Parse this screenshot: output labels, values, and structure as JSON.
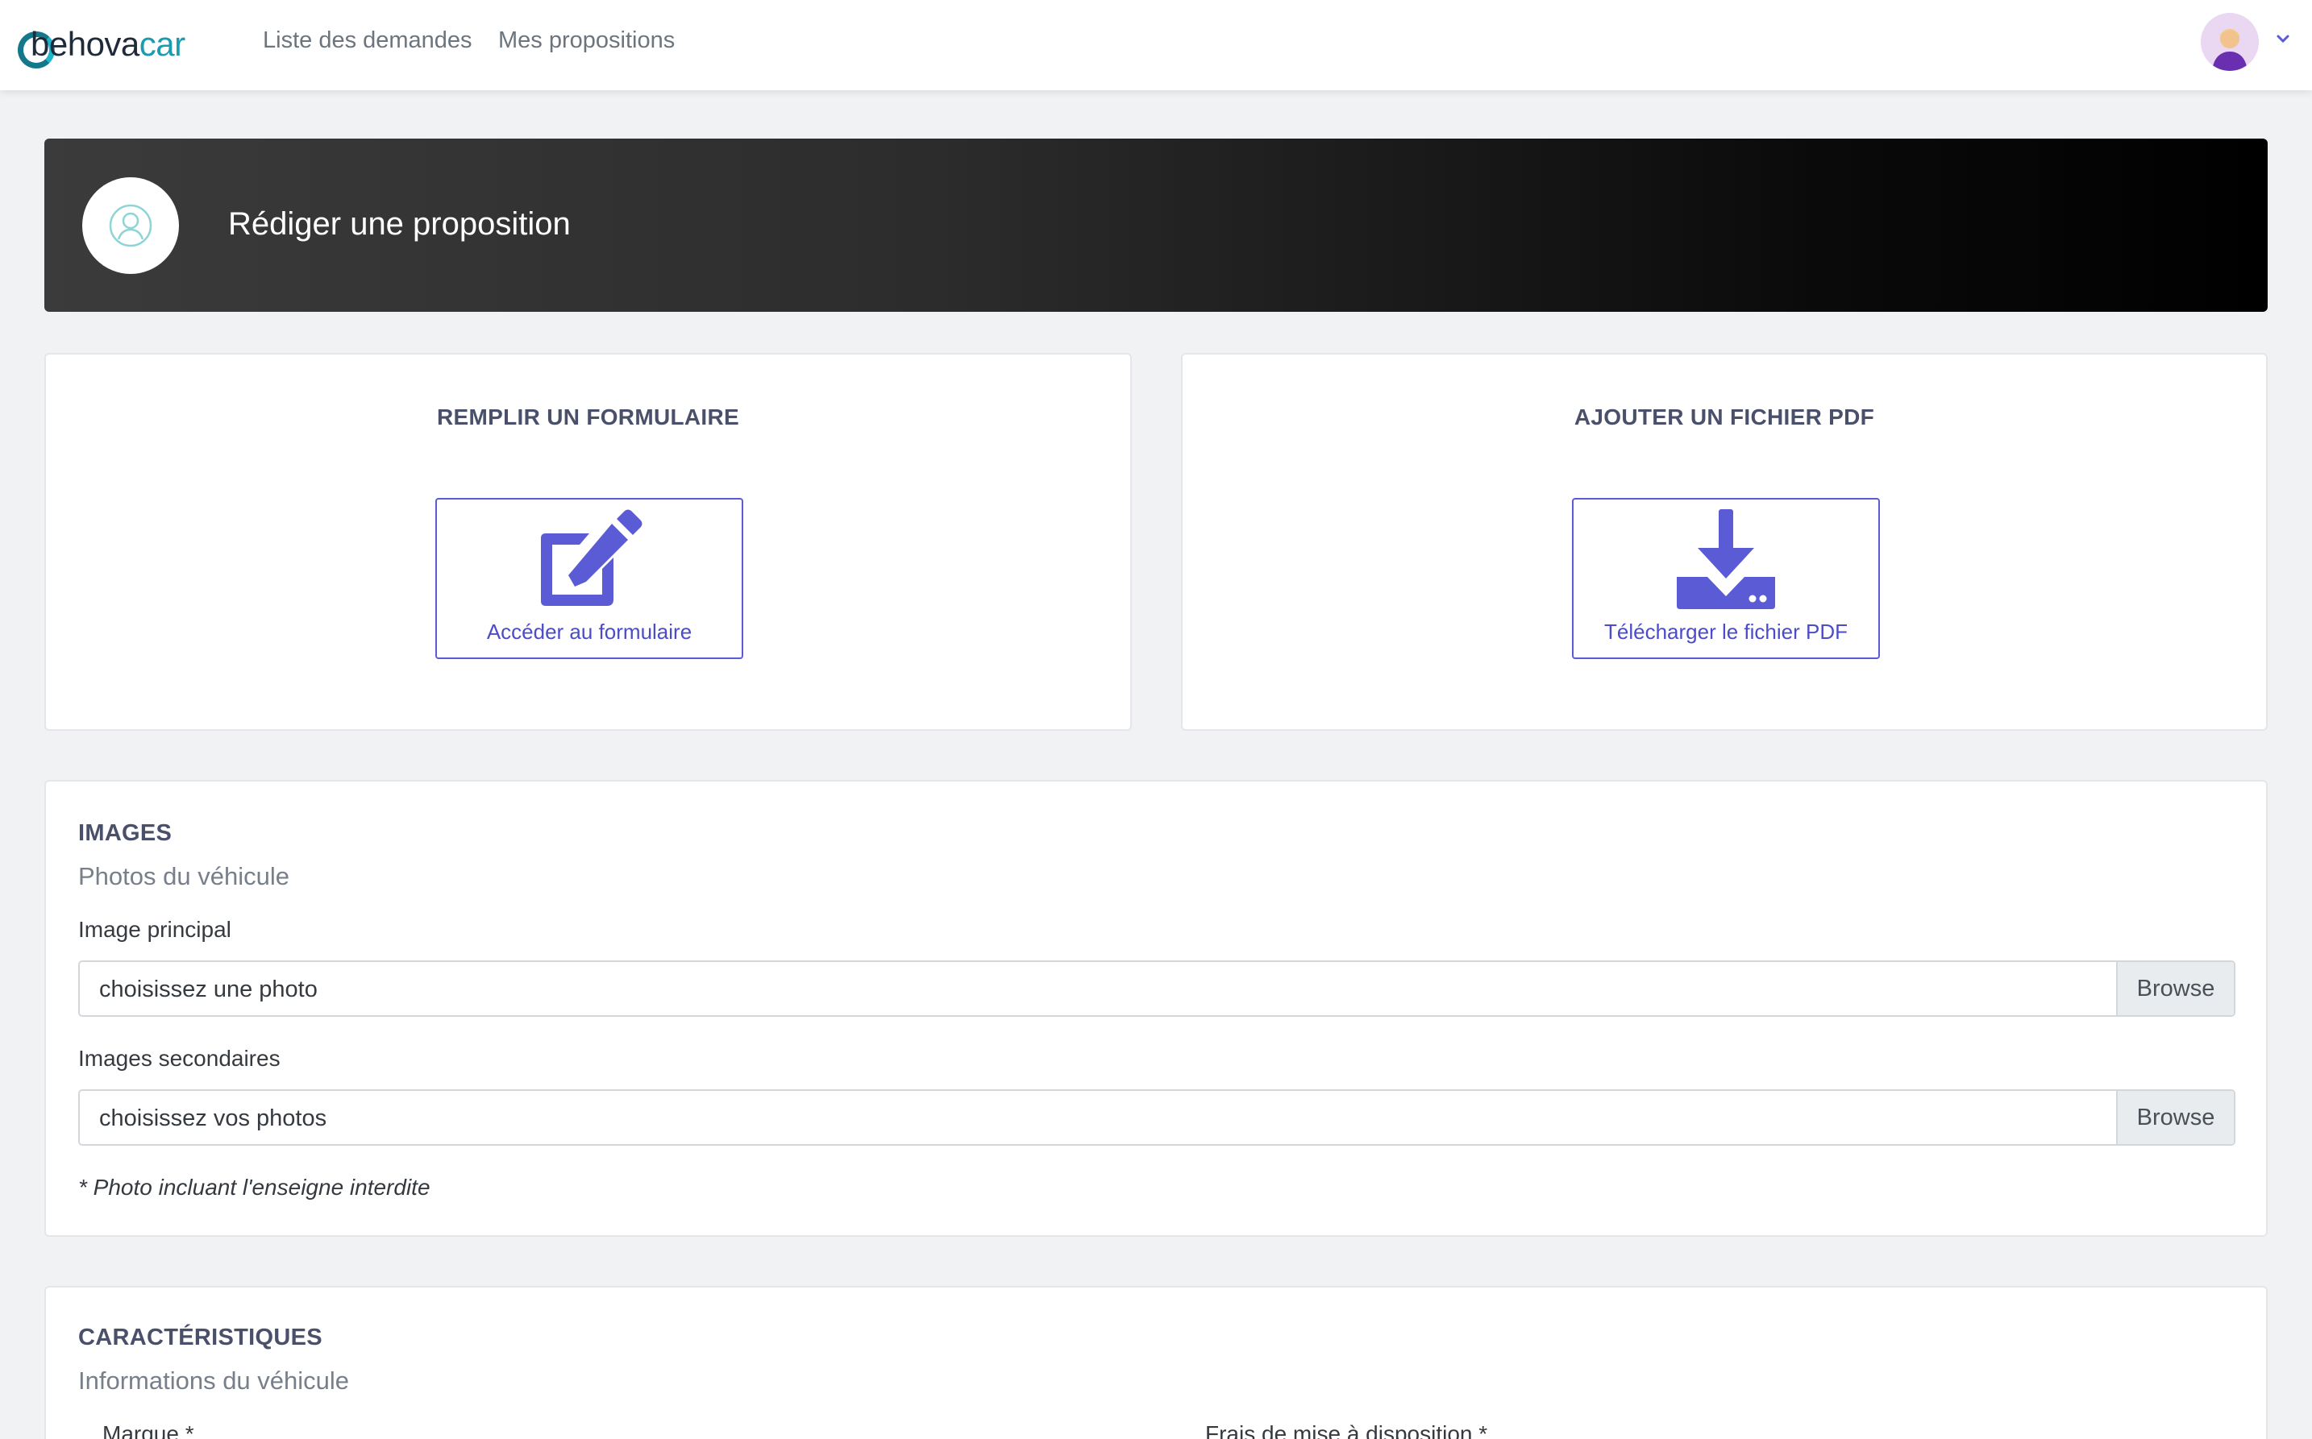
{
  "nav": {
    "logo_prefix": "behova",
    "logo_suffix": "car",
    "links": [
      "Liste des demandes",
      "Mes propositions"
    ]
  },
  "banner": {
    "title": "Rédiger une proposition"
  },
  "options": {
    "form": {
      "title": "REMPLIR UN FORMULAIRE",
      "button": "Accéder au formulaire",
      "icon": "edit-icon"
    },
    "pdf": {
      "title": "AJOUTER UN FICHIER PDF",
      "button": "Télécharger le fichier PDF",
      "icon": "download-icon"
    }
  },
  "images": {
    "title": "IMAGES",
    "subtitle": "Photos du véhicule",
    "main_label": "Image principal",
    "main_placeholder": "choisissez une photo",
    "secondary_label": "Images secondaires",
    "secondary_placeholder": "choisissez vos photos",
    "browse": "Browse",
    "note": "* Photo incluant l'enseigne interdite"
  },
  "characteristics": {
    "title": "CARACTÉRISTIQUES",
    "subtitle": "Informations du véhicule",
    "brand_label": "Marque *",
    "fees_label": "Frais de mise à disposition *"
  },
  "colors": {
    "accent": "#5b5bd6",
    "brand_teal": "#1b9bb0"
  }
}
